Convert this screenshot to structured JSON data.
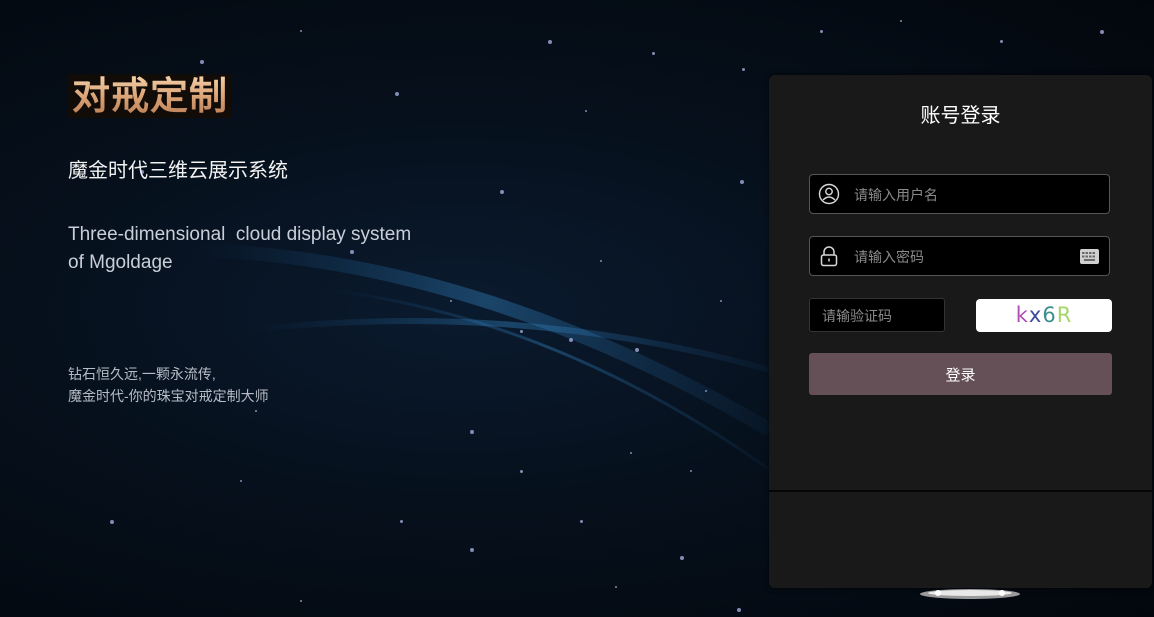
{
  "hero": {
    "logo_text": "对戒定制",
    "subtitle": "魔金时代三维云展示系统",
    "en_line1": "Three-dimensional  cloud display system",
    "en_line2": "of Mgoldage",
    "slogan_line1": "钻石恒久远,一颗永流传,",
    "slogan_line2": "魔金时代-你的珠宝对戒定制大师"
  },
  "login": {
    "title": "账号登录",
    "username_placeholder": "请输入用户名",
    "username_value": "",
    "password_placeholder": "请输入密码",
    "password_value": "",
    "captcha_placeholder": "请输验证码",
    "captcha_value": "",
    "captcha_chars": [
      "k",
      "x",
      "6",
      "R"
    ],
    "captcha_colors": [
      "#b04fb5",
      "#3a4a9c",
      "#3b8e8c",
      "#a4d66a"
    ],
    "submit_label": "登录"
  },
  "icons": {
    "username": "user-icon",
    "password": "lock-icon",
    "keyboard": "keyboard-icon"
  },
  "colors": {
    "panel_bg": "#191919",
    "button_bg": "#665058",
    "logo_gold": "#d8a073"
  }
}
